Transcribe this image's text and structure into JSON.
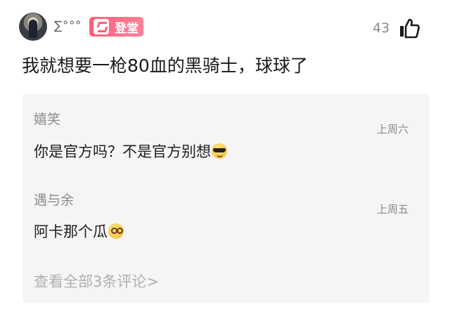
{
  "post": {
    "username": "∑°°°",
    "badge_label": "登堂",
    "like_count": "43",
    "content": "我就想要一枪80血的黑骑士，球球了"
  },
  "comments": [
    {
      "name": "嬉笑",
      "time": "上周六",
      "text": "你是官方吗？不是官方别想",
      "emoji": "smiling-face-with-sunglasses"
    },
    {
      "name": "遇与余",
      "time": "上周五",
      "text": "阿卡那个瓜",
      "emoji": "woozy-face"
    }
  ],
  "view_all_label": "查看全部3条评论>",
  "colors": {
    "badge": "#ff6b85",
    "panel": "#f5f5f5"
  }
}
